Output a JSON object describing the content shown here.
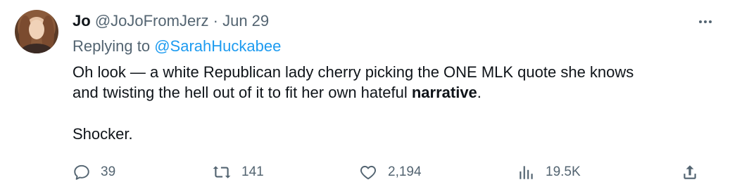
{
  "author": {
    "name": "Jo",
    "handle": "@JoJoFromJerz",
    "separator": "·",
    "date": "Jun 29",
    "avatar_icon": "user-avatar-icon"
  },
  "reply": {
    "prefix": "Replying to",
    "mention": "@SarahHuckabee"
  },
  "text": {
    "line1": "Oh look — a white Republican lady cherry picking the ONE MLK quote she knows",
    "line2_before": "and twisting the hell out of it to fit her own hateful ",
    "line2_bold": "narrative",
    "line2_after": ".",
    "line3": "Shocker."
  },
  "actions": {
    "replies": "39",
    "reposts": "141",
    "likes": "2,194",
    "views": "19.5K"
  },
  "colors": {
    "text": "#0f1419",
    "muted": "#536471",
    "link": "#1d9bf0",
    "background": "#ffffff"
  },
  "icons": {
    "more": "more-icon",
    "reply": "reply-icon",
    "repost": "repost-icon",
    "like": "like-icon",
    "views": "views-icon",
    "share": "share-icon"
  }
}
